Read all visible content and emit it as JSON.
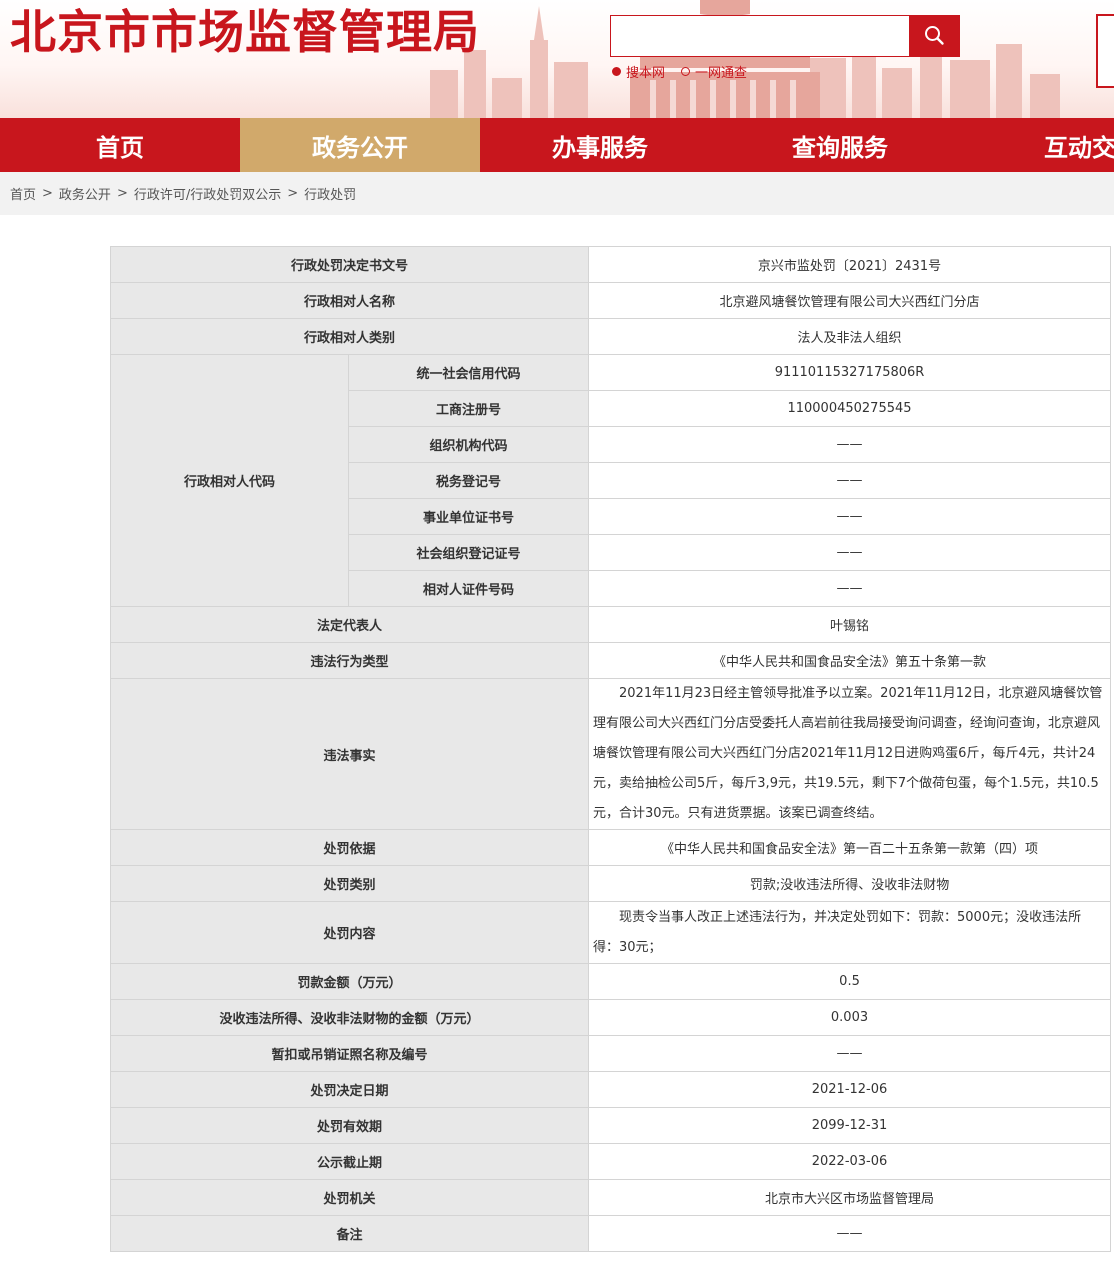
{
  "header": {
    "site_title": "北京市市场监督管理局",
    "search": {
      "placeholder": "",
      "button_icon": "search-icon"
    },
    "scope_options": [
      {
        "label": "搜本网",
        "checked": true
      },
      {
        "label": "一网通查",
        "checked": false
      }
    ],
    "accent_color": "#c8161d"
  },
  "nav": {
    "items": [
      "首页",
      "政务公开",
      "办事服务",
      "查询服务",
      "互动交"
    ],
    "active_index": 1
  },
  "breadcrumb": [
    "首页",
    "政务公开",
    "行政许可/行政处罚双公示",
    "行政处罚"
  ],
  "breadcrumb_separator": ">",
  "record": {
    "doc_no_label": "行政处罚决定书文号",
    "doc_no": "京兴市监处罚〔2021〕2431号",
    "party_name_label": "行政相对人名称",
    "party_name": "北京避风塘餐饮管理有限公司大兴西红门分店",
    "party_type_label": "行政相对人类别",
    "party_type": "法人及非法人组织",
    "party_code_label": "行政相对人代码",
    "codes": [
      {
        "label": "统一社会信用代码",
        "value": "91110115327175806R"
      },
      {
        "label": "工商注册号",
        "value": "110000450275545"
      },
      {
        "label": "组织机构代码",
        "value": "——"
      },
      {
        "label": "税务登记号",
        "value": "——"
      },
      {
        "label": "事业单位证书号",
        "value": "——"
      },
      {
        "label": "社会组织登记证号",
        "value": "——"
      },
      {
        "label": "相对人证件号码",
        "value": "——"
      }
    ],
    "legal_rep_label": "法定代表人",
    "legal_rep": "叶锡铭",
    "violation_type_label": "违法行为类型",
    "violation_type": "《中华人民共和国食品安全法》第五十条第一款",
    "facts_label": "违法事实",
    "facts": "2021年11月23日经主管领导批准予以立案。2021年11月12日，北京避风塘餐饮管理有限公司大兴西红门分店受委托人高岩前往我局接受询问调查，经询问查询，北京避风塘餐饮管理有限公司大兴西红门分店2021年11月12日进购鸡蛋6斤，每斤4元，共计24元，卖给抽检公司5斤，每斤3,9元，共19.5元，剩下7个做荷包蛋，每个1.5元，共10.5元，合计30元。只有进货票据。该案已调查终结。",
    "basis_label": "处罚依据",
    "basis": "《中华人民共和国食品安全法》第一百二十五条第一款第（四）项",
    "penalty_type_label": "处罚类别",
    "penalty_type": "罚款;没收违法所得、没收非法财物",
    "penalty_content_label": "处罚内容",
    "penalty_content": "现责令当事人改正上述违法行为，并决定处罚如下：罚款：5000元；没收违法所得：30元；",
    "fine_label": "罚款金额（万元）",
    "fine": "0.5",
    "confiscation_label": "没收违法所得、没收非法财物的金额（万元）",
    "confiscation": "0.003",
    "license_label": "暂扣或吊销证照名称及编号",
    "license": "——",
    "decision_date_label": "处罚决定日期",
    "decision_date": "2021-12-06",
    "valid_until_label": "处罚有效期",
    "valid_until": "2099-12-31",
    "publish_until_label": "公示截止期",
    "publish_until": "2022-03-06",
    "authority_label": "处罚机关",
    "authority": "北京市大兴区市场监督管理局",
    "remark_label": "备注",
    "remark": "——"
  }
}
